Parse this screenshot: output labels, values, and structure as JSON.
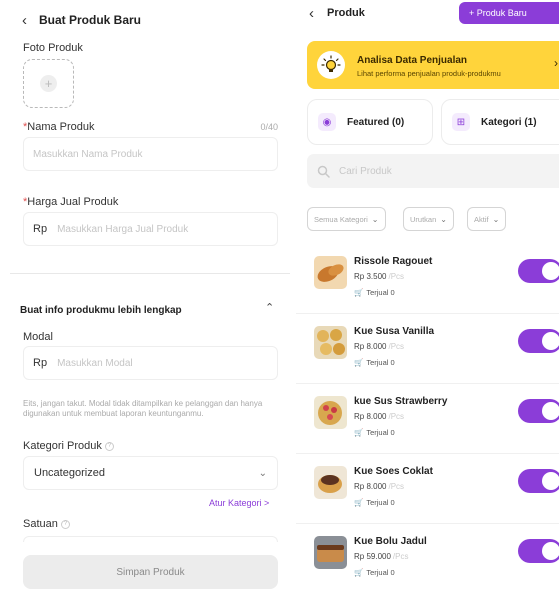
{
  "left": {
    "header": {
      "title": "Buat Produk Baru"
    },
    "photo": {
      "label": "Foto Produk"
    },
    "name": {
      "label": "Nama Produk",
      "counter": "0/40",
      "placeholder": "Masukkan Nama Produk"
    },
    "price": {
      "label": "Harga Jual Produk",
      "currency": "Rp",
      "placeholder": "Masukkan Harga Jual Produk"
    },
    "more_section": {
      "title": "Buat info produkmu lebih lengkap"
    },
    "modal": {
      "label": "Modal",
      "currency": "Rp",
      "placeholder": "Masukkan Modal",
      "hint": "Eits, jangan takut. Modal tidak ditampilkan ke pelanggan dan hanya digunakan untuk membuat laporan keuntunganmu."
    },
    "category": {
      "label": "Kategori Produk",
      "selected": "Uncategorized",
      "manage_link": "Atur Kategori >"
    },
    "unit": {
      "label": "Satuan"
    },
    "save_button": "Simpan Produk"
  },
  "right": {
    "header": {
      "title": "Produk",
      "add_button": "+ Produk Baru"
    },
    "banner": {
      "title": "Analisa Data Penjualan",
      "subtitle": "Lihat performa penjualan produk-produkmu"
    },
    "cards": [
      {
        "label": "Featured (0)",
        "icon": "trophy-icon"
      },
      {
        "label": "Kategori (1)",
        "icon": "grid-icon"
      }
    ],
    "search": {
      "placeholder": "Cari Produk"
    },
    "filters": [
      {
        "label": "Semua Kategori"
      },
      {
        "label": "Urutkan"
      },
      {
        "label": "Aktif"
      }
    ],
    "products": [
      {
        "name": "Rissole Ragouet",
        "price": "Rp 3.500",
        "unit": "/Pcs",
        "sold": "Terjual 0",
        "active": true
      },
      {
        "name": "Kue Susa Vanilla",
        "price": "Rp 8.000",
        "unit": "/Pcs",
        "sold": "Terjual 0",
        "active": true
      },
      {
        "name": "kue Sus Strawberry",
        "price": "Rp 8.000",
        "unit": "/Pcs",
        "sold": "Terjual 0",
        "active": true
      },
      {
        "name": "Kue Soes Coklat",
        "price": "Rp 8.000",
        "unit": "/Pcs",
        "sold": "Terjual 0",
        "active": true
      },
      {
        "name": "Kue Bolu Jadul",
        "price": "Rp 59.000",
        "unit": "/Pcs",
        "sold": "Terjual 0",
        "active": true
      }
    ],
    "colors": {
      "accent": "#8b3dd8",
      "banner": "#ffd43b"
    }
  }
}
